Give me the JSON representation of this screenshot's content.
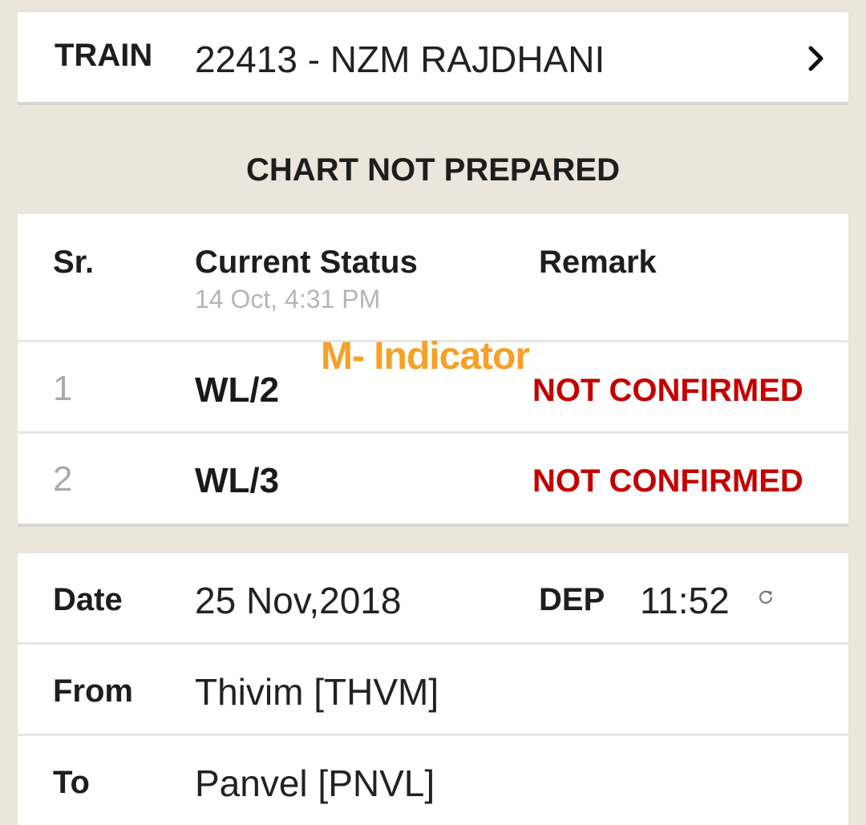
{
  "train": {
    "label": "TRAIN",
    "value": "22413 - NZM RAJDHANI",
    "chevron_icon": "chevron-right-icon"
  },
  "chart_status": "CHART NOT PREPARED",
  "status_table": {
    "headers": {
      "sr": "Sr.",
      "current_status": "Current Status",
      "remark": "Remark"
    },
    "updated_at": "14 Oct, 4:31 PM",
    "rows": [
      {
        "sr": "1",
        "status": "WL/2",
        "remark": "NOT CONFIRMED"
      },
      {
        "sr": "2",
        "status": "WL/3",
        "remark": "NOT CONFIRMED"
      }
    ]
  },
  "watermark": "M- Indicator",
  "journey": {
    "date_label": "Date",
    "date_value": "25 Nov,2018",
    "dep_label": "DEP",
    "dep_value": "11:52",
    "refresh_icon": "refresh-icon",
    "from_label": "From",
    "from_value": "Thivim [THVM]",
    "to_label": "To",
    "to_value": "Panvel [PNVL]"
  },
  "colors": {
    "background": "#ebe5db",
    "remark_red": "#c40000",
    "watermark_orange": "#f6a028"
  }
}
